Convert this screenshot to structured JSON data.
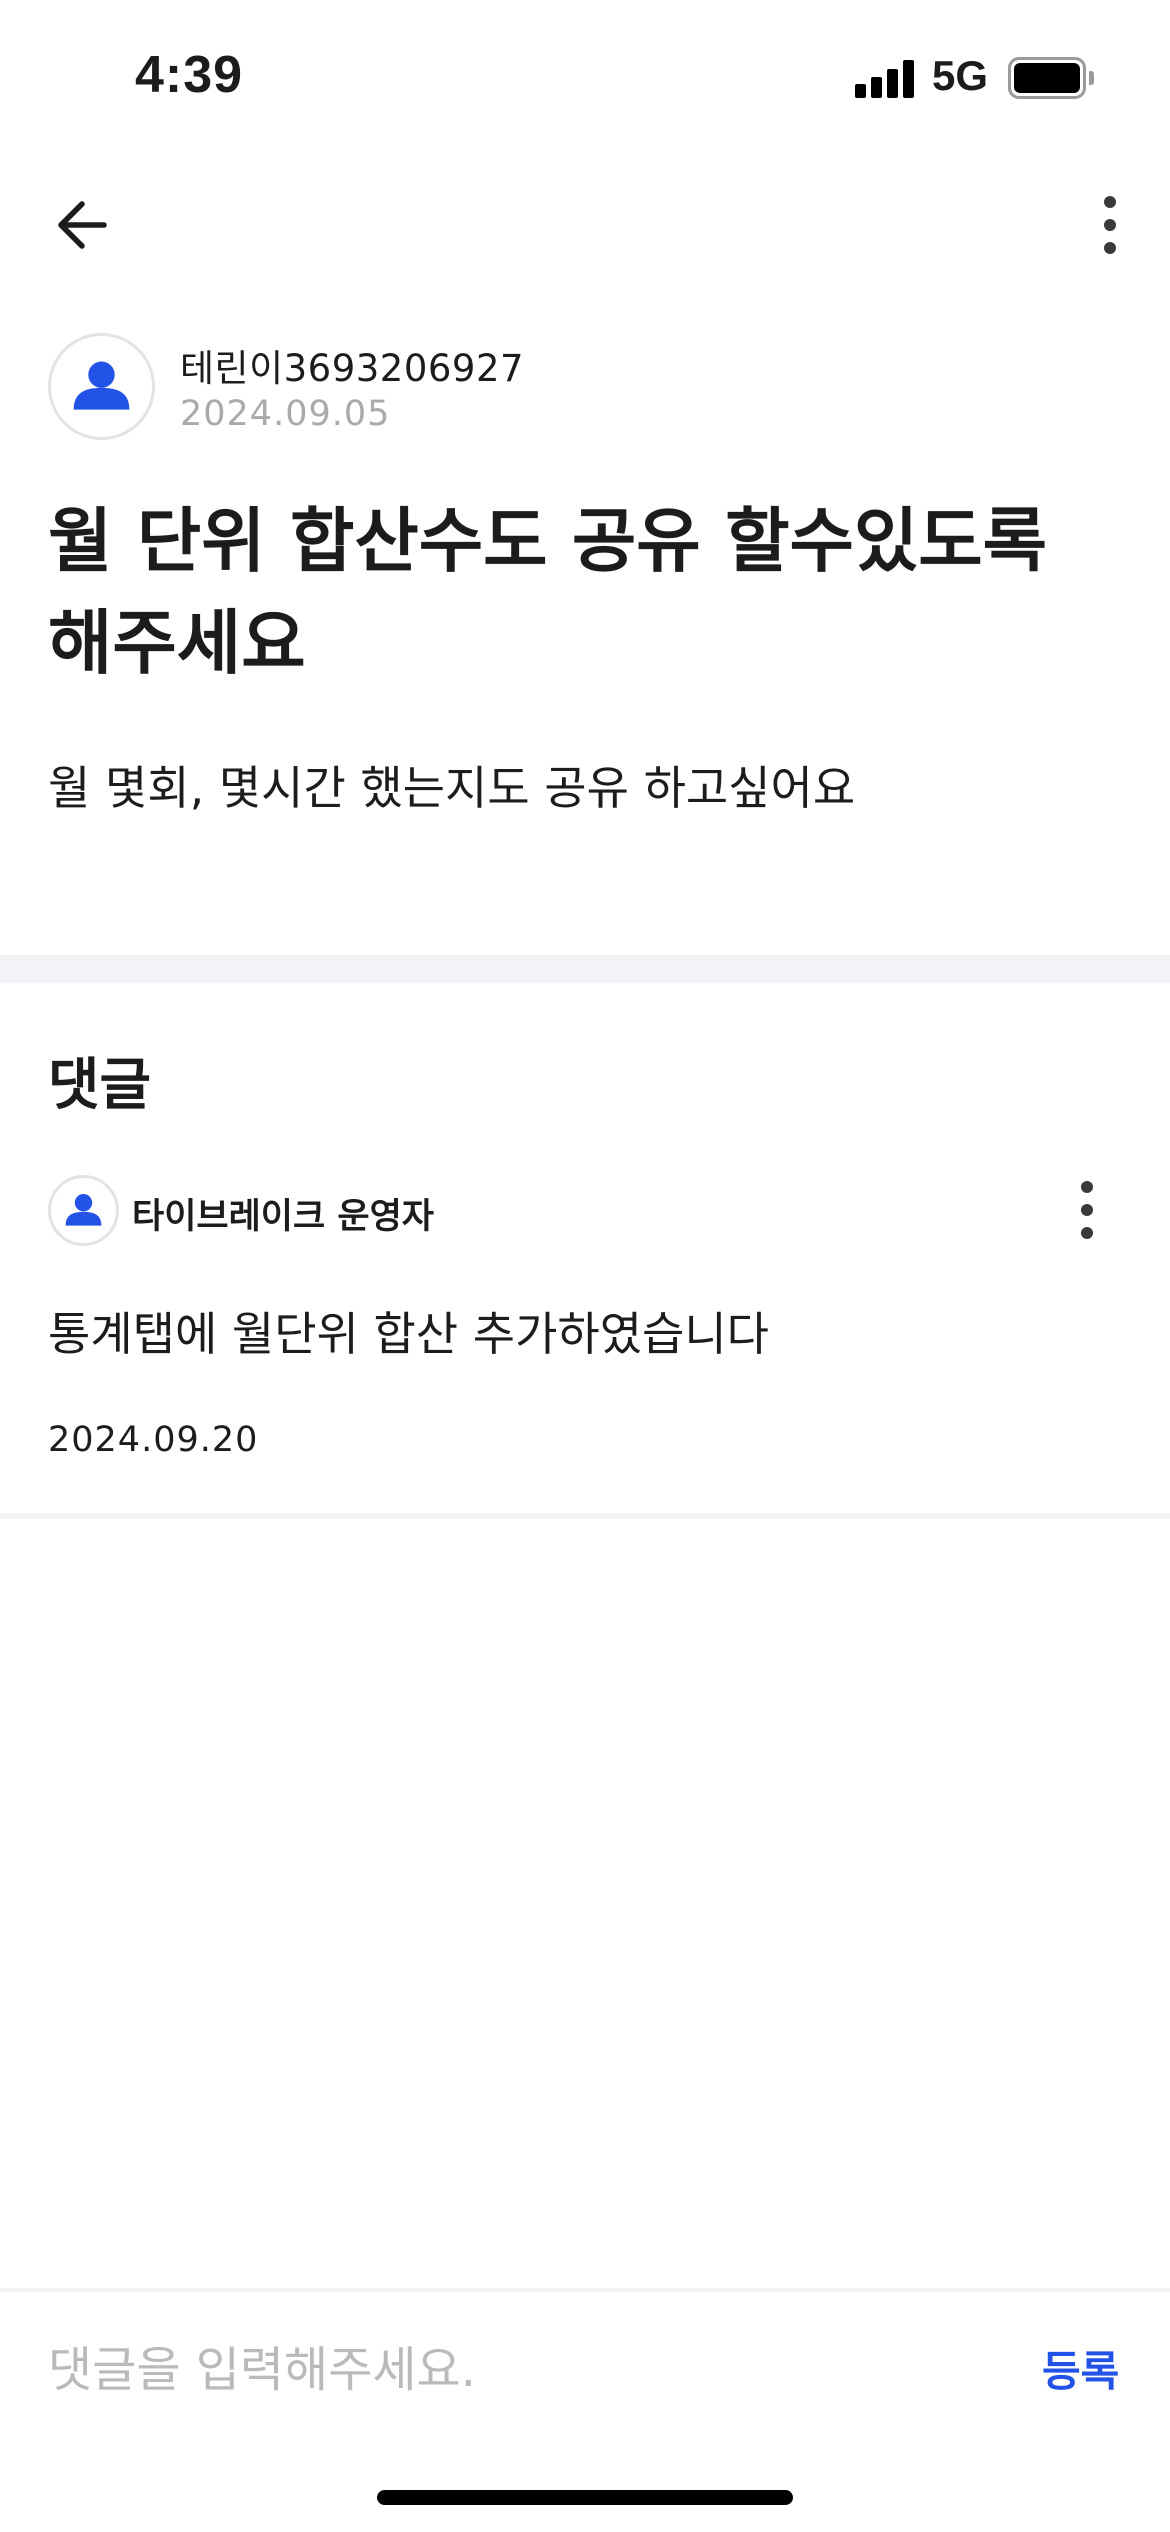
{
  "status_bar": {
    "time": "4:39",
    "network": "5G",
    "signal_icon": "cellular-signal-icon",
    "battery_icon": "battery-full-icon"
  },
  "nav": {
    "back_icon": "arrow-left-icon",
    "more_icon": "more-vertical-icon"
  },
  "post": {
    "author": "테린이3693206927",
    "date": "2024.09.05",
    "title": "월 단위 합산수도 공유 할수있도록 해주세요",
    "body": "월 몇회, 몇시간 했는지도 공유 하고싶어요",
    "avatar_icon": "user-avatar-icon"
  },
  "comments": {
    "heading": "댓글",
    "items": [
      {
        "author": "타이브레이크 운영자",
        "text": "통계탭에 월단위 합산 추가하였습니다",
        "date": "2024.09.20",
        "avatar_icon": "user-avatar-icon",
        "more_icon": "more-vertical-icon"
      }
    ]
  },
  "comment_input": {
    "placeholder": "댓글을 입력해주세요.",
    "value": "",
    "submit_label": "등록"
  },
  "colors": {
    "accent": "#2353e6",
    "text_primary": "#1c1c1e",
    "text_muted": "#a9a9ae",
    "divider": "#f2f3f7"
  }
}
